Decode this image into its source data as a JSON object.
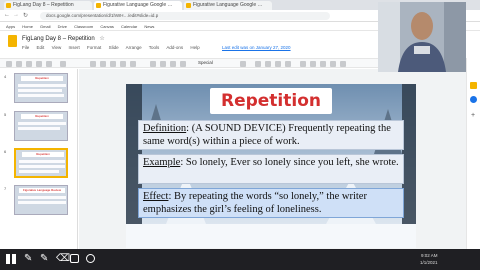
{
  "browser": {
    "tabs": [
      {
        "label": "FigLang Day 8 – Repetition"
      },
      {
        "label": "Figurative Language Google …"
      },
      {
        "label": "Figurative Language Google …"
      }
    ],
    "url": "docs.google.com/presentation/d/1hWH…/edit#slide=id.p"
  },
  "bookmarks": [
    "Apps",
    "Home",
    "Gmail",
    "Drive",
    "Classroom",
    "Canvas",
    "Calendar",
    "News"
  ],
  "doc": {
    "title": "FigLang Day 8 – Repetition",
    "star": "☆",
    "menus": [
      "File",
      "Edit",
      "View",
      "Insert",
      "Format",
      "Slide",
      "Arrange",
      "Tools",
      "Add-ons",
      "Help"
    ],
    "last_edit": "Last edit was on January 27, 2020",
    "font": "Special"
  },
  "filmstrip": {
    "slide_numbers": [
      "4",
      "5",
      "6",
      "7"
    ],
    "thumb_titles": [
      "Repetition",
      "Repetition",
      "Repetition",
      "Figurative Language Review"
    ]
  },
  "slide": {
    "title": "Repetition",
    "definition": {
      "label": "Definition",
      "text": ": (A SOUND DEVICE) Frequently repeating the same word(s) within a piece of work."
    },
    "example": {
      "label": "Example",
      "text": ": So lonely, Ever so lonely since you left, she wrote."
    },
    "effect": {
      "label": "Effect",
      "text": ": By repeating the words “so lonely,” the writer emphasizes the girl’s feeling of loneliness."
    }
  },
  "taskbar": {
    "time": "9:02 AM",
    "date": "1/1/2021"
  },
  "colors": {
    "title_red": "#d32f2f",
    "selection_yellow": "#f4b400",
    "card_blue": "#e9eef6"
  }
}
